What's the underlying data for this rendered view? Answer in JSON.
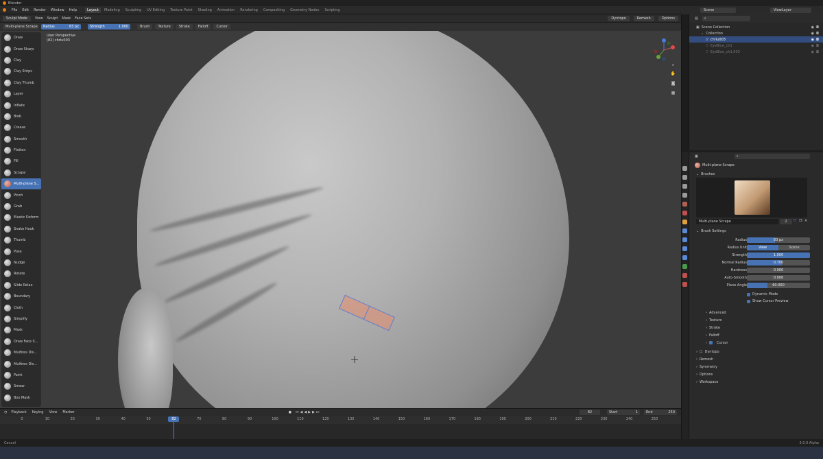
{
  "window": {
    "title": "Blender"
  },
  "menubar": {
    "menus": [
      "File",
      "Edit",
      "Render",
      "Window",
      "Help"
    ],
    "workspaces": [
      "Layout",
      "Modeling",
      "Sculpting",
      "UV Editing",
      "Texture Paint",
      "Shading",
      "Animation",
      "Rendering",
      "Compositing",
      "Geometry Nodes",
      "Scripting"
    ],
    "active_workspace": "Layout",
    "scene": "Scene",
    "view_layer": "ViewLayer"
  },
  "viewport_header": {
    "mode": "Sculpt Mode",
    "menus": [
      "View",
      "Sculpt",
      "Mask",
      "Face Sets"
    ],
    "dyntopo": "Dyntopo",
    "remesh": "Remesh",
    "options": "Options"
  },
  "tool_header": {
    "tool": "Multi-plane Scrape",
    "radius_label": "Radius",
    "radius_value": "83 px",
    "strength_label": "Strength",
    "strength_value": "1.000",
    "dropdowns": [
      "Brush",
      "Texture",
      "Stroke",
      "Falloff",
      "Cursor"
    ]
  },
  "viewport": {
    "line1": "User Perspective",
    "line2": "(82) chrlu003"
  },
  "tools": [
    {
      "label": "Draw"
    },
    {
      "label": "Draw Sharp"
    },
    {
      "label": "Clay"
    },
    {
      "label": "Clay Strips"
    },
    {
      "label": "Clay Thumb"
    },
    {
      "label": "Layer"
    },
    {
      "label": "Inflate"
    },
    {
      "label": "Blob"
    },
    {
      "label": "Crease"
    },
    {
      "label": "Smooth"
    },
    {
      "label": "Flatten"
    },
    {
      "label": "Fill"
    },
    {
      "label": "Scrape"
    },
    {
      "label": "Multi-plane S..."
    },
    {
      "label": "Pinch"
    },
    {
      "label": "Grab"
    },
    {
      "label": "Elastic Deform"
    },
    {
      "label": "Snake Hook"
    },
    {
      "label": "Thumb"
    },
    {
      "label": "Pose"
    },
    {
      "label": "Nudge"
    },
    {
      "label": "Rotate"
    },
    {
      "label": "Slide Relax"
    },
    {
      "label": "Boundary"
    },
    {
      "label": "Cloth"
    },
    {
      "label": "Simplify"
    },
    {
      "label": "Mask"
    },
    {
      "label": "Draw Face S..."
    },
    {
      "label": "Multires Dis..."
    },
    {
      "label": "Multires Dis..."
    },
    {
      "label": "Paint"
    },
    {
      "label": "Smear"
    },
    {
      "label": "Box Mask"
    }
  ],
  "active_tool_index": 13,
  "timeline": {
    "menus": [
      "Playback",
      "Keying",
      "View",
      "Marker"
    ],
    "current_frame": "82",
    "start_label": "Start",
    "start": "1",
    "end_label": "End",
    "end": "250",
    "ticks": [
      "0",
      "10",
      "20",
      "30",
      "40",
      "50",
      "60",
      "70",
      "80",
      "90",
      "100",
      "110",
      "120",
      "130",
      "140",
      "150",
      "160",
      "170",
      "180",
      "190",
      "200",
      "210",
      "220",
      "230",
      "240",
      "250"
    ],
    "playhead_frame": 60
  },
  "statusbar": {
    "left": "Cancel",
    "right": "3.0.0 Alpha"
  },
  "outliner": {
    "rows": [
      {
        "label": "Scene Collection",
        "indent": 0,
        "style": ""
      },
      {
        "label": "Collection",
        "indent": 1,
        "style": ""
      },
      {
        "label": "chrlu003",
        "indent": 2,
        "style": "sel"
      },
      {
        "label": "EyeBlue_ch1",
        "indent": 2,
        "style": "dim"
      },
      {
        "label": "EyeBlue_ch1.003",
        "indent": 2,
        "style": "dim"
      }
    ]
  },
  "properties": {
    "brush_name": "Multi-plane Scrape",
    "brushes_section": "Brushes",
    "brush_preview_name": "Multi-plane Scrape",
    "brush_users": "2",
    "brush_settings_section": "Brush Settings",
    "rows": [
      {
        "label": "Radius",
        "value": "83 px",
        "fill": 0.45
      },
      {
        "label": "Radius Unit",
        "value": "",
        "fill": 0
      },
      {
        "label": "Strength",
        "value": "1.000",
        "fill": 1.0
      },
      {
        "label": "Normal Radius",
        "value": "0.700",
        "fill": 0.55
      },
      {
        "label": "Hardness",
        "value": "0.000",
        "fill": 0
      },
      {
        "label": "Auto-Smooth",
        "value": "0.000",
        "fill": 0
      },
      {
        "label": "Plane Angle",
        "value": "60.000",
        "fill": 0.33
      }
    ],
    "radius_unit_options": [
      "View",
      "Scene"
    ],
    "checks": [
      "Dynamic Mode",
      "Show Cursor Preview"
    ],
    "subsections": [
      "Advanced",
      "Texture",
      "Stroke",
      "Falloff",
      "Cursor"
    ],
    "sections": [
      "Dyntopo",
      "Remesh",
      "Symmetry",
      "Options",
      "Workspace"
    ]
  }
}
